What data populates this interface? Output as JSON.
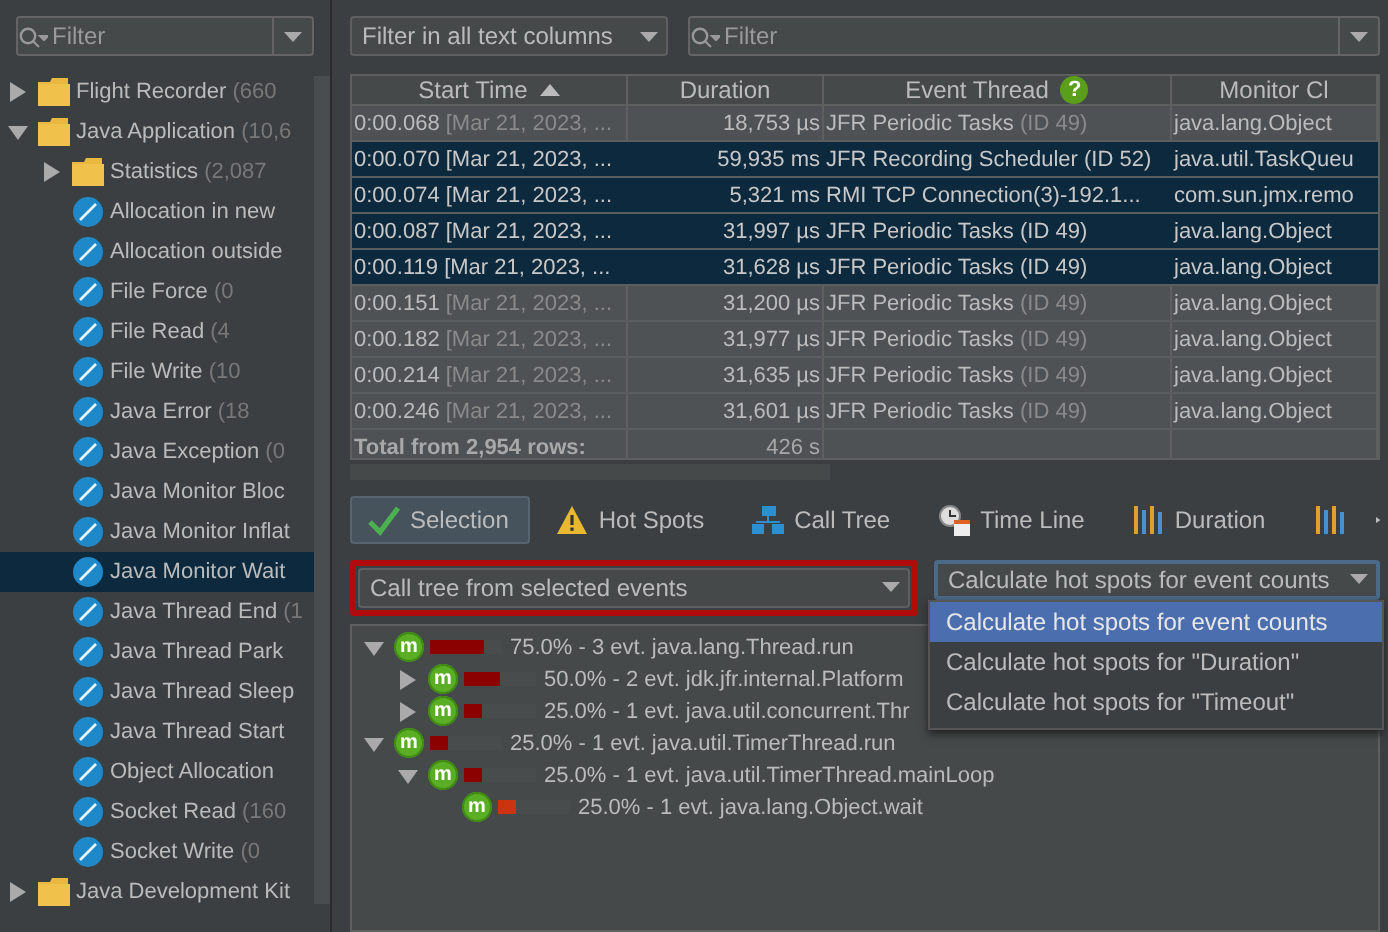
{
  "event_filter": {
    "placeholder": "Filter"
  },
  "event_tree": [
    {
      "kind": "folder",
      "name": "Flight Recorder",
      "count": "(660",
      "expanded": false,
      "selected": false
    },
    {
      "kind": "folder",
      "name": "Java Application",
      "count": "(10,6",
      "expanded": true,
      "selected": false,
      "children": [
        {
          "kind": "folder",
          "name": "Statistics",
          "count": "(2,087",
          "expanded": false,
          "selected": false
        },
        {
          "kind": "event",
          "name": "Allocation in new",
          "selected": false
        },
        {
          "kind": "event",
          "name": "Allocation outside",
          "selected": false
        },
        {
          "kind": "event",
          "name": "File Force",
          "count": "(0",
          "selected": false
        },
        {
          "kind": "event",
          "name": "File Read",
          "count": "(4",
          "selected": false
        },
        {
          "kind": "event",
          "name": "File Write",
          "count": "(10",
          "selected": false
        },
        {
          "kind": "event",
          "name": "Java Error",
          "count": "(18",
          "selected": false
        },
        {
          "kind": "event",
          "name": "Java Exception",
          "count": "(0",
          "selected": false
        },
        {
          "kind": "event",
          "name": "Java Monitor Bloc",
          "selected": false
        },
        {
          "kind": "event",
          "name": "Java Monitor Inflat",
          "selected": false
        },
        {
          "kind": "event",
          "name": "Java Monitor Wait",
          "selected": true
        },
        {
          "kind": "event",
          "name": "Java Thread End",
          "count": "(1",
          "selected": false
        },
        {
          "kind": "event",
          "name": "Java Thread Park",
          "selected": false
        },
        {
          "kind": "event",
          "name": "Java Thread Sleep",
          "selected": false
        },
        {
          "kind": "event",
          "name": "Java Thread Start",
          "selected": false
        },
        {
          "kind": "event",
          "name": "Object Allocation",
          "selected": false
        },
        {
          "kind": "event",
          "name": "Socket Read",
          "count": "(160",
          "selected": false
        },
        {
          "kind": "event",
          "name": "Socket Write",
          "count": "(0",
          "selected": false
        }
      ]
    },
    {
      "kind": "folder",
      "name": "Java Development Kit",
      "expanded": false,
      "selected": false
    }
  ],
  "column_filter_mode": {
    "value": "Filter in all text columns"
  },
  "table_filter": {
    "placeholder": "Filter"
  },
  "table": {
    "columns": [
      {
        "label": "Start Time",
        "sorted": true
      },
      {
        "label": "Duration",
        "sorted": false
      },
      {
        "label": "Event Thread",
        "sorted": false,
        "help": "?"
      },
      {
        "label": "Monitor Cl",
        "sorted": false
      }
    ],
    "rows": [
      {
        "selected": false,
        "time": "0:00.068",
        "time_detail": "[Mar 21, 2023, ...",
        "duration": "18,753 µs",
        "thread": "JFR Periodic Tasks",
        "thread_id": "(ID 49)",
        "monitor_class": "java.lang.Object"
      },
      {
        "selected": true,
        "time": "0:00.070",
        "time_detail": "[Mar 21, 2023, ...",
        "duration": "59,935 ms",
        "thread": "JFR Recording Scheduler",
        "thread_id": "(ID 52)",
        "monitor_class": "java.util.TaskQueu"
      },
      {
        "selected": true,
        "time": "0:00.074",
        "time_detail": "[Mar 21, 2023, ...",
        "duration": "5,321 ms",
        "thread": "RMI TCP Connection(3)-192.1...",
        "monitor_class": "com.sun.jmx.remo"
      },
      {
        "selected": true,
        "time": "0:00.087",
        "time_detail": "[Mar 21, 2023, ...",
        "duration": "31,997 µs",
        "thread": "JFR Periodic Tasks",
        "thread_id": "(ID 49)",
        "monitor_class": "java.lang.Object"
      },
      {
        "selected": true,
        "time": "0:00.119",
        "time_detail": "[Mar 21, 2023, ...",
        "duration": "31,628 µs",
        "thread": "JFR Periodic Tasks",
        "thread_id": "(ID 49)",
        "monitor_class": "java.lang.Object"
      },
      {
        "selected": false,
        "time": "0:00.151",
        "time_detail": "[Mar 21, 2023, ...",
        "duration": "31,200 µs",
        "thread": "JFR Periodic Tasks",
        "thread_id": "(ID 49)",
        "monitor_class": "java.lang.Object"
      },
      {
        "selected": false,
        "time": "0:00.182",
        "time_detail": "[Mar 21, 2023, ...",
        "duration": "31,977 µs",
        "thread": "JFR Periodic Tasks",
        "thread_id": "(ID 49)",
        "monitor_class": "java.lang.Object"
      },
      {
        "selected": false,
        "time": "0:00.214",
        "time_detail": "[Mar 21, 2023, ...",
        "duration": "31,635 µs",
        "thread": "JFR Periodic Tasks",
        "thread_id": "(ID 49)",
        "monitor_class": "java.lang.Object"
      },
      {
        "selected": false,
        "time": "0:00.246",
        "time_detail": "[Mar 21, 2023, ...",
        "duration": "31,601 µs",
        "thread": "JFR Periodic Tasks",
        "thread_id": "(ID 49)",
        "monitor_class": "java.lang.Object"
      }
    ],
    "total": {
      "label": "Total from 2,954 rows:",
      "duration": "426 s"
    }
  },
  "view_tabs": [
    {
      "kind": "selection",
      "label": "Selection",
      "selected": true
    },
    {
      "kind": "hotspots",
      "label": "Hot Spots",
      "selected": false
    },
    {
      "kind": "calltree",
      "label": "Call Tree",
      "selected": false
    },
    {
      "kind": "timeline",
      "label": "Time Line",
      "selected": false
    },
    {
      "kind": "duration",
      "label": "Duration",
      "selected": false
    },
    {
      "kind": "duration",
      "selected": false
    }
  ],
  "call_tree_mode": {
    "value": "Call tree from selected events",
    "highlighted": true
  },
  "hot_spot_mode": {
    "value": "Calculate hot spots for event counts",
    "expanded": true,
    "options": [
      {
        "label": "Calculate hot spots for event counts",
        "selected": true
      },
      {
        "label": "Calculate hot spots for \"Duration\"",
        "selected": false
      },
      {
        "label": "Calculate hot spots for \"Timeout\"",
        "selected": false
      }
    ]
  },
  "call_tree": [
    {
      "icon": "m",
      "text": "75.0% - 3 evt. java.lang.Thread.run",
      "level": 0.75,
      "color": "#8b0000",
      "expanded": true,
      "children": [
        {
          "icon": "m",
          "text": "50.0% - 2 evt. jdk.jfr.internal.Platform",
          "level": 0.5,
          "color": "#8b0000",
          "expanded": false
        },
        {
          "icon": "m",
          "text": "25.0% - 1 evt. java.util.concurrent.Thr",
          "level": 0.25,
          "color": "#8b0000",
          "expanded": false
        }
      ]
    },
    {
      "icon": "m",
      "text": "25.0% - 1 evt. java.util.TimerThread.run",
      "level": 0.25,
      "color": "#8b0000",
      "expanded": true,
      "children": [
        {
          "icon": "m",
          "text": "25.0% - 1 evt. java.util.TimerThread.mainLoop",
          "level": 0.25,
          "color": "#8b0000",
          "expanded": true,
          "children": [
            {
              "icon": "m",
              "text": "25.0% - 1 evt. java.lang.Object.wait",
              "level": 0.25,
              "color": "#cc3311"
            }
          ]
        }
      ]
    }
  ]
}
